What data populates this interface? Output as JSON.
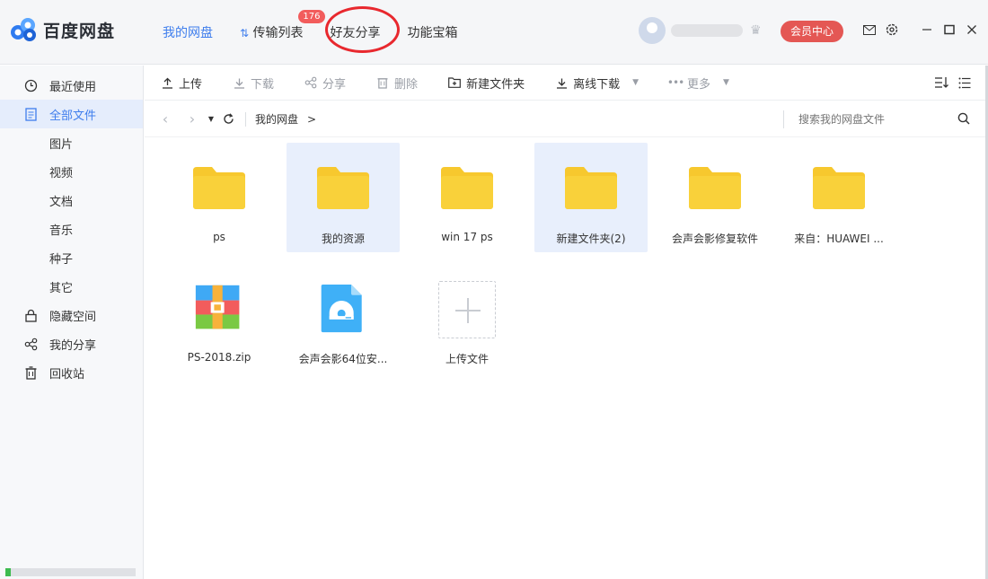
{
  "app": {
    "name": "百度网盘"
  },
  "nav": [
    {
      "label": "我的网盘",
      "active": true
    },
    {
      "label": "传输列表",
      "badge": "176"
    },
    {
      "label": "好友分享"
    },
    {
      "label": "功能宝箱"
    }
  ],
  "header": {
    "vip_label": "会员中心"
  },
  "sidebar": {
    "items": [
      {
        "label": "最近使用",
        "icon": "clock-icon"
      },
      {
        "label": "全部文件",
        "icon": "document-icon",
        "active": true
      },
      {
        "label": "图片"
      },
      {
        "label": "视频"
      },
      {
        "label": "文档"
      },
      {
        "label": "音乐"
      },
      {
        "label": "种子"
      },
      {
        "label": "其它"
      },
      {
        "label": "隐藏空间",
        "icon": "lock-icon"
      },
      {
        "label": "我的分享",
        "icon": "share-icon"
      },
      {
        "label": "回收站",
        "icon": "trash-icon"
      }
    ],
    "storage_progress": 0.04
  },
  "toolbar": {
    "upload": "上传",
    "download": "下载",
    "share": "分享",
    "delete": "删除",
    "new_folder": "新建文件夹",
    "offline_download": "离线下载",
    "more": "更多"
  },
  "path": {
    "crumb": "我的网盘",
    "arrow": ">",
    "search_placeholder": "搜索我的网盘文件"
  },
  "files": [
    {
      "name": "ps",
      "type": "folder"
    },
    {
      "name": "我的资源",
      "type": "folder",
      "selected": true
    },
    {
      "name": "win 17 ps",
      "type": "folder"
    },
    {
      "name": "新建文件夹(2)",
      "type": "folder",
      "selected": true
    },
    {
      "name": "会声会影修复软件",
      "type": "folder"
    },
    {
      "name": "来自：HUAWEI ...",
      "type": "folder"
    },
    {
      "name": "PS-2018.zip",
      "type": "zip"
    },
    {
      "name": "会声会影64位安...",
      "type": "disc"
    },
    {
      "name": "上传文件",
      "type": "upload"
    }
  ],
  "colors": {
    "accent": "#3f7eed",
    "folder": "#f7c82e",
    "vip": "#e45754",
    "highlight": "#e8282e"
  }
}
